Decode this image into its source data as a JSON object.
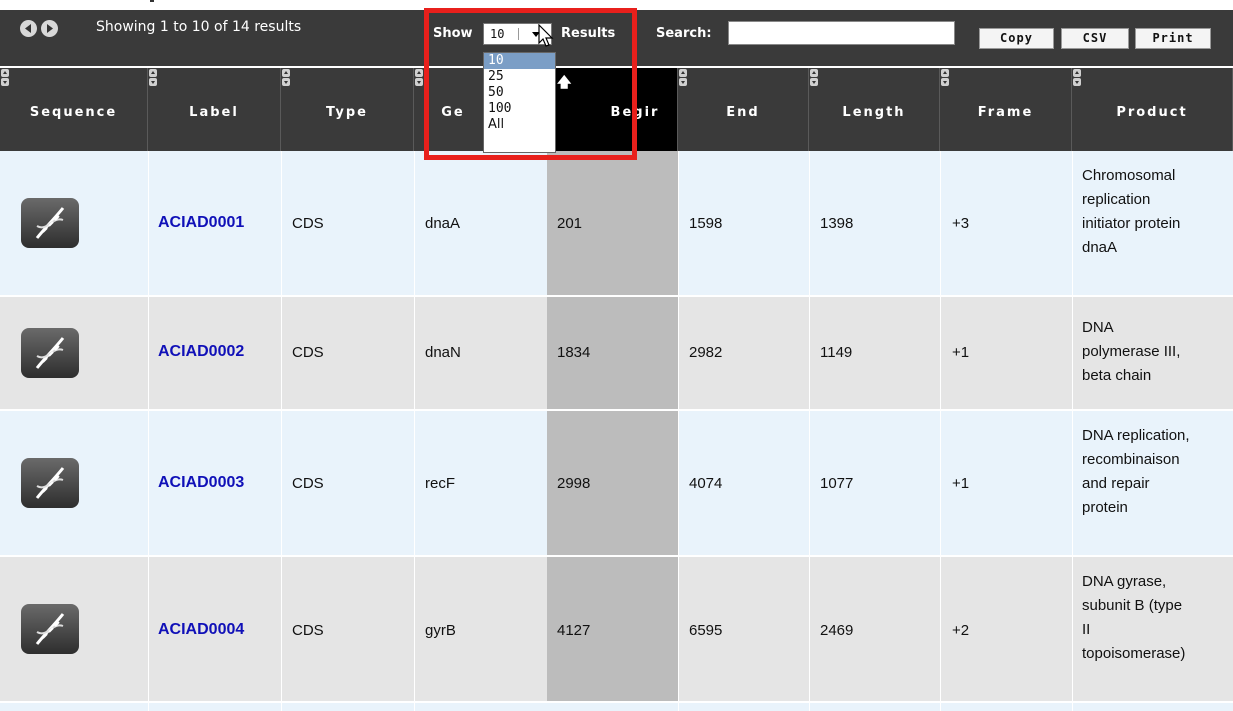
{
  "toolbar": {
    "showing_text": "Showing 1 to 10 of 14 results",
    "show_label": "Show",
    "results_label": "Results",
    "search_label": "Search:",
    "search_value": "",
    "copy_label": "Copy",
    "csv_label": "CSV",
    "print_label": "Print"
  },
  "page_length": {
    "selected": "10",
    "options": [
      "10",
      "25",
      "50",
      "100",
      "All"
    ]
  },
  "columns": [
    "Sequence",
    "Label",
    "Type",
    "Ge",
    "Begin",
    "End",
    "Length",
    "Frame",
    "Product"
  ],
  "header_display": {
    "gene_partial": "Ge",
    "begin_partial": "Begir"
  },
  "rows": [
    {
      "label": "ACIAD0001",
      "type": "CDS",
      "gene": "dnaA",
      "begin": "201",
      "end": "1598",
      "length": "1398",
      "frame": "+3",
      "product": [
        "Chromosomal",
        "replication",
        "initiator protein",
        "dnaA"
      ]
    },
    {
      "label": "ACIAD0002",
      "type": "CDS",
      "gene": "dnaN",
      "begin": "1834",
      "end": "2982",
      "length": "1149",
      "frame": "+1",
      "product": [
        "DNA",
        "polymerase III,",
        "beta chain"
      ]
    },
    {
      "label": "ACIAD0003",
      "type": "CDS",
      "gene": "recF",
      "begin": "2998",
      "end": "4074",
      "length": "1077",
      "frame": "+1",
      "product": [
        "DNA replication,",
        "recombinaison",
        "and repair",
        "protein"
      ]
    },
    {
      "label": "ACIAD0004",
      "type": "CDS",
      "gene": "gyrB",
      "begin": "4127",
      "end": "6595",
      "length": "2469",
      "frame": "+2",
      "product": [
        "DNA gyrase,",
        "subunit B (type",
        "II",
        "topoisomerase)"
      ]
    }
  ],
  "colors": {
    "toolbar_bg": "#3a3a3a",
    "sorted_header_bg": "#000000",
    "odd_row_bg": "#e9f3fb",
    "even_row_bg": "#e5e5e5",
    "begin_column_bg": "#bcbcbc",
    "link_color": "#1010b8",
    "highlight_box": "#e8201c",
    "selected_option_bg": "#7b9ec6"
  },
  "icons": {
    "prev": "chevron-left-circle-icon",
    "next": "chevron-right-circle-icon",
    "sequence": "dna-helix-icon",
    "sort": "sort-up-down-icon",
    "sorted_ascending": "arrow-up-icon",
    "cursor": "mouse-pointer-icon"
  }
}
